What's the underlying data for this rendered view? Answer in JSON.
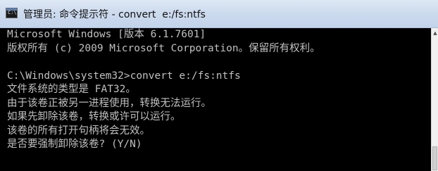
{
  "window": {
    "title": "管理员: 命令提示符 - convert  e:/fs:ntfs",
    "icon_name": "cmd-icon",
    "icon_text": "C:\\"
  },
  "console": {
    "text_color": "#c0c0c0",
    "background_color": "#000000",
    "lines": [
      "Microsoft Windows [版本 6.1.7601]",
      "版权所有 (c) 2009 Microsoft Corporation。保留所有权利。",
      "",
      "C:\\Windows\\system32>convert e:/fs:ntfs",
      "文件系统的类型是 FAT32。",
      "由于该卷正被另一进程使用，转换无法运行。",
      "如果先卸除该卷，转换或许可以运行。",
      "该卷的所有打开句柄将会无效。",
      "是否要强制卸除该卷? (Y/N)"
    ]
  },
  "scrollbar": {
    "up_arrow_icon": "chevron-up-icon",
    "up_arrow_glyph": "▲"
  }
}
